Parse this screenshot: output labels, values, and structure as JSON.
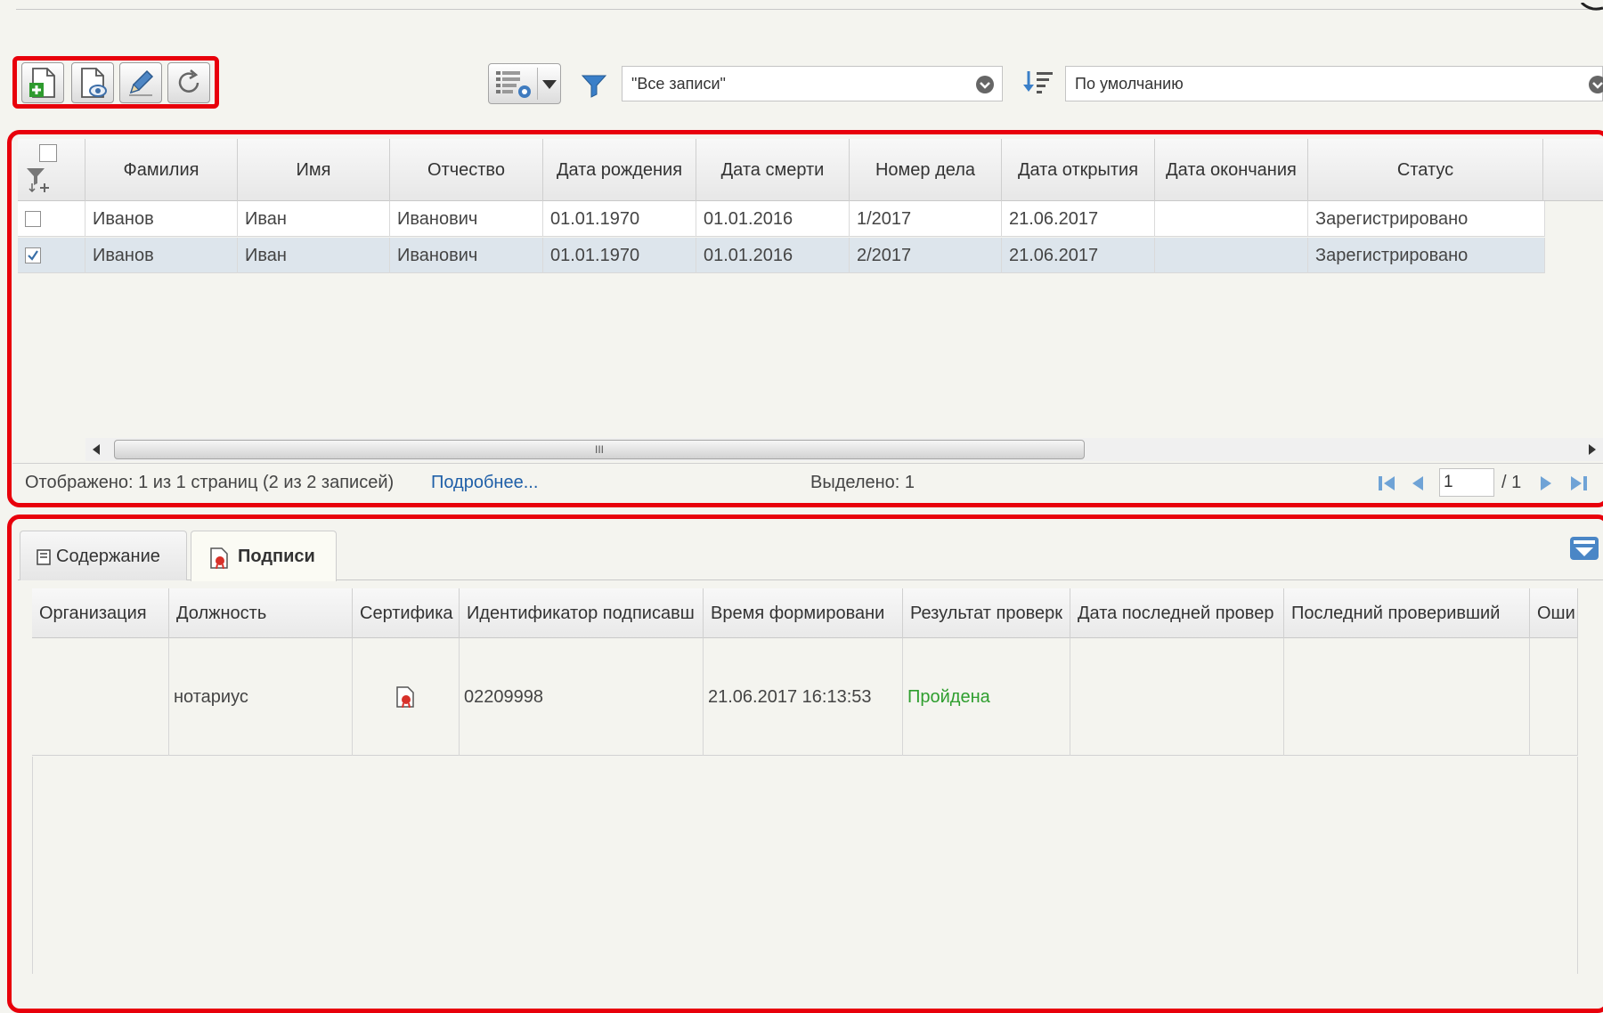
{
  "toolbar": {
    "buttons": [
      {
        "name": "add-record-button",
        "icon": "document-plus-icon"
      },
      {
        "name": "view-record-button",
        "icon": "document-view-icon"
      },
      {
        "name": "edit-record-button",
        "icon": "pencil-icon"
      },
      {
        "name": "refresh-button",
        "icon": "refresh-icon"
      }
    ],
    "filter_value": "\"Все записи\"",
    "sort_value": "По умолчанию"
  },
  "main_grid": {
    "columns": [
      "Фамилия",
      "Имя",
      "Отчество",
      "Дата рождения",
      "Дата смерти",
      "Номер дела",
      "Дата открытия",
      "Дата окончания",
      "Статус"
    ],
    "rows": [
      {
        "checked": false,
        "selected": false,
        "cells": [
          "Иванов",
          "Иван",
          "Иванович",
          "01.01.1970",
          "01.01.2016",
          "1/2017",
          "21.06.2017",
          "",
          "Зарегистрировано"
        ]
      },
      {
        "checked": true,
        "selected": true,
        "cells": [
          "Иванов",
          "Иван",
          "Иванович",
          "01.01.1970",
          "01.01.2016",
          "2/2017",
          "21.06.2017",
          "",
          "Зарегистрировано"
        ]
      }
    ],
    "scroll_grip": "III"
  },
  "status_bar": {
    "shown": "Отображено: 1 из 1 страниц (2 из 2 записей)",
    "more_link": "Подробнее...",
    "selected": "Выделено: 1",
    "page_input": "1",
    "page_total": "/ 1"
  },
  "tabs": [
    {
      "label": "Содержание",
      "active": false,
      "icon": "document-icon"
    },
    {
      "label": "Подписи",
      "active": true,
      "icon": "signature-icon"
    }
  ],
  "signatures_grid": {
    "columns": [
      "Организация",
      "Должность",
      "Сертифика",
      "Идентификатор подписавш",
      "Время формировани",
      "Результат проверк",
      "Дата последней провер",
      "Последний проверивший",
      "Оши"
    ],
    "row": {
      "organization": "",
      "position": "нотариус",
      "certificate_icon": "certificate-icon",
      "signer_id": "02209998",
      "time": "21.06.2017 16:13:53",
      "result": "Пройдена",
      "last_check_date": "",
      "last_checker": "",
      "error": ""
    }
  },
  "colors": {
    "highlight_frame": "#e8000b",
    "link": "#1f5fa8",
    "success": "#2e9e2e",
    "selected_row": "#dde5ec"
  }
}
